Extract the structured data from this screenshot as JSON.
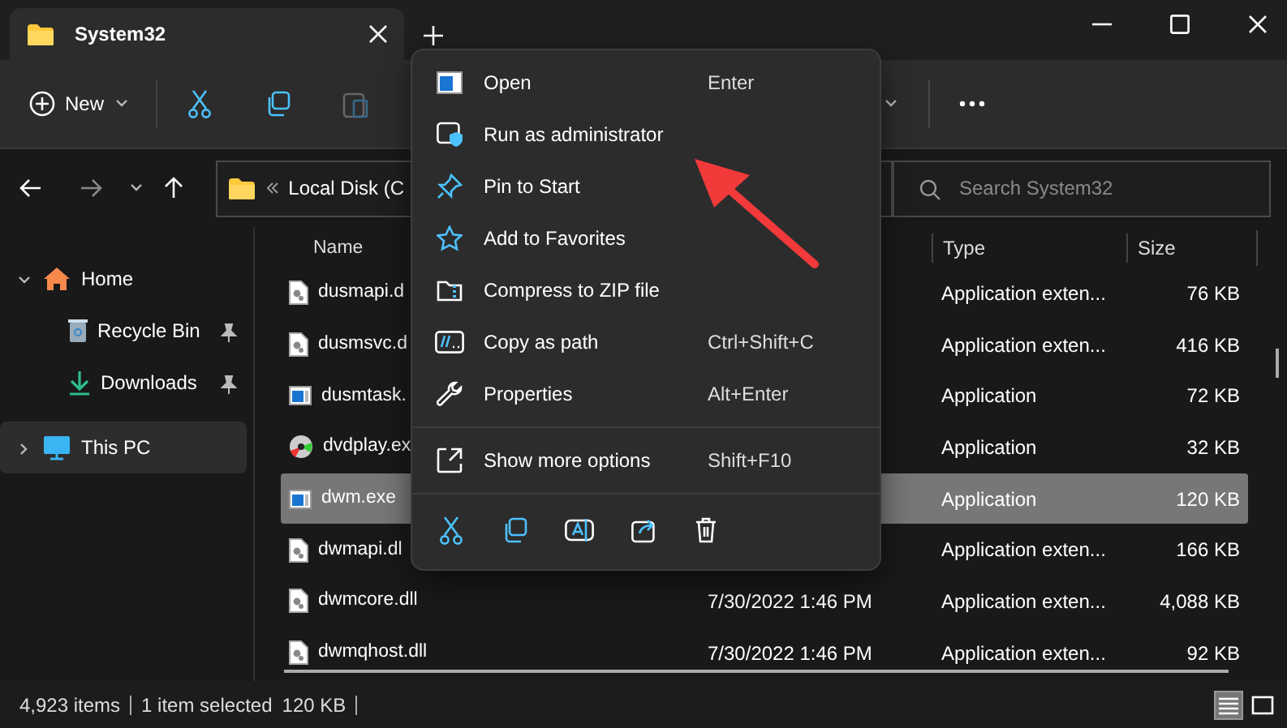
{
  "window": {
    "tabs": [
      {
        "title": "System32",
        "selected": true
      }
    ]
  },
  "toolbar": {
    "new_label": "New"
  },
  "address_bar": {
    "path": "Local Disk (C"
  },
  "search": {
    "placeholder": "Search System32"
  },
  "sidebar": {
    "items": [
      {
        "label": "Home",
        "kind": "group",
        "expanded": true,
        "selected": false
      },
      {
        "label": "Recycle Bin",
        "kind": "quick",
        "pinned": true,
        "selected": false
      },
      {
        "label": "Downloads",
        "kind": "quick",
        "pinned": true,
        "selected": false
      },
      {
        "label": "This PC",
        "kind": "group",
        "expanded": false,
        "selected": true
      }
    ]
  },
  "table": {
    "columns": [
      "Name",
      "Type",
      "Size"
    ],
    "rows": [
      {
        "name": "dusmapi.d",
        "type": "Application exten...",
        "size": "76 KB",
        "kind": "library",
        "selected": false
      },
      {
        "name": "dusmsvc.d",
        "type": "Application exten...",
        "size": "416 KB",
        "kind": "library",
        "selected": false
      },
      {
        "name": "dusmtask.",
        "type": "Application",
        "size": "72 KB",
        "kind": "app",
        "selected": false
      },
      {
        "name": "dvdplay.ex",
        "type": "Application",
        "size": "32 KB",
        "kind": "disc",
        "selected": false
      },
      {
        "name": "dwm.exe",
        "type": "Application",
        "size": "120 KB",
        "kind": "app",
        "selected": true
      },
      {
        "name": "dwmapi.dl",
        "type": "Application exten...",
        "size": "166 KB",
        "kind": "library",
        "selected": false
      },
      {
        "name": "dwmcore.dll",
        "date": "7/30/2022 1:46 PM",
        "type": "Application exten...",
        "size": "4,088 KB",
        "kind": "library",
        "selected": false
      },
      {
        "name": "dwmqhost.dll",
        "date": "7/30/2022 1:46 PM",
        "type": "Application exten...",
        "size": "92 KB",
        "kind": "library",
        "selected": false
      }
    ]
  },
  "context_menu": {
    "items": [
      {
        "kind": "item",
        "label": "Open",
        "shortcut": "Enter"
      },
      {
        "kind": "item",
        "label": "Run as administrator"
      },
      {
        "kind": "item",
        "label": "Pin to Start"
      },
      {
        "kind": "item",
        "label": "Add to Favorites"
      },
      {
        "kind": "item",
        "label": "Compress to ZIP file"
      },
      {
        "kind": "item",
        "label": "Copy as path",
        "shortcut": "Ctrl+Shift+C"
      },
      {
        "kind": "item",
        "label": "Properties",
        "shortcut": "Alt+Enter"
      },
      {
        "kind": "separator"
      },
      {
        "kind": "item",
        "label": "Show more options",
        "shortcut": "Shift+F10"
      },
      {
        "kind": "separator"
      }
    ]
  },
  "status_bar": {
    "item_count": "4,923 items",
    "selection": "1 item selected",
    "selection_size": "120 KB",
    "view_buttons": [
      {
        "kind": "details",
        "selected": true
      },
      {
        "kind": "tiles",
        "selected": false
      }
    ]
  }
}
